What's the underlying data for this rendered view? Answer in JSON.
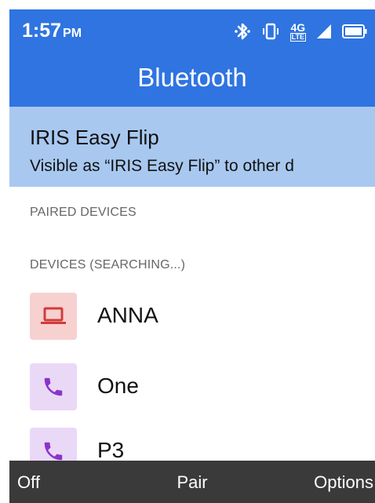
{
  "status": {
    "time": "1:57",
    "ampm": "PM",
    "network": "4G",
    "network_sub": "LTE"
  },
  "header": {
    "title": "Bluetooth"
  },
  "this_device": {
    "name": "IRIS Easy Flip",
    "subtitle": "Visible as “IRIS Easy Flip” to other d"
  },
  "sections": {
    "paired": "PAIRED DEVICES",
    "available": "DEVICES (SEARCHING...)"
  },
  "devices": [
    {
      "label": "ANNA",
      "icon": "laptop-icon",
      "icon_bg": "#f7d0d0",
      "icon_color": "#d23b3b"
    },
    {
      "label": "One",
      "icon": "phone-icon",
      "icon_bg": "#ead8f7",
      "icon_color": "#8a35c8"
    },
    {
      "label": "P3",
      "icon": "phone-icon",
      "icon_bg": "#ead8f7",
      "icon_color": "#8a35c8"
    }
  ],
  "softkeys": {
    "left": "Off",
    "center": "Pair",
    "right": "Options"
  },
  "colors": {
    "accent": "#2f74e0",
    "selected": "#a8c8f0",
    "softkey_bar": "#3a3a3a"
  }
}
